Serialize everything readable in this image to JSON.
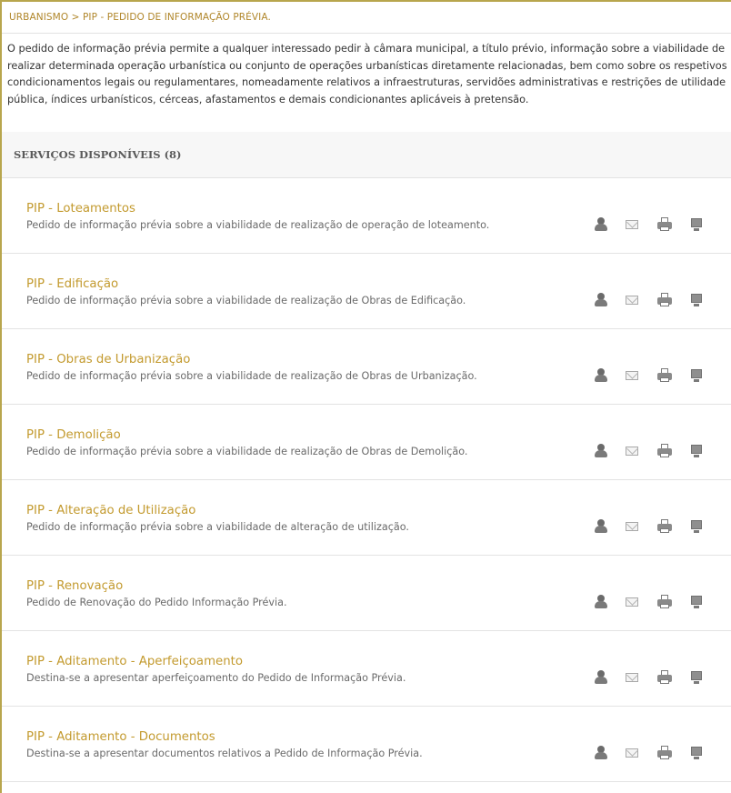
{
  "breadcrumb": "URBANISMO > PIP - PEDIDO DE INFORMAÇÃO PRÉVIA.",
  "intro": "O pedido de informação prévia permite a qualquer interessado pedir à câmara municipal, a título prévio, informação sobre a viabilidade de realizar determinada operação urbanística ou conjunto de operações urbanísticas diretamente relacionadas, bem como sobre os respetivos condicionamentos legais ou regulamentares, nomeadamente relativos a infraestruturas, servidões administrativas e restrições de utilidade pública, índices urbanísticos, cérceas, afastamentos e demais condicionantes aplicáveis à pretensão.",
  "section_title": "SERVIÇOS DISPONÍVEIS (8)",
  "services": [
    {
      "title": "PIP - Loteamentos",
      "description": "Pedido de informação prévia sobre a viabilidade de realização de operação de loteamento."
    },
    {
      "title": "PIP - Edificação",
      "description": "Pedido de informação prévia sobre a viabilidade de realização de Obras de Edificação."
    },
    {
      "title": "PIP - Obras de Urbanização",
      "description": "Pedido de informação prévia sobre a viabilidade de realização de Obras de Urbanização."
    },
    {
      "title": "PIP - Demolição",
      "description": "Pedido de informação prévia sobre a viabilidade de realização de Obras de Demolição."
    },
    {
      "title": "PIP - Alteração de Utilização",
      "description": "Pedido de informação prévia sobre a viabilidade de alteração de utilização."
    },
    {
      "title": "PIP - Renovação",
      "description": "Pedido de Renovação do Pedido Informação Prévia."
    },
    {
      "title": "PIP - Aditamento - Aperfeiçoamento",
      "description": "Destina-se a apresentar aperfeiçoamento do Pedido de Informação Prévia."
    },
    {
      "title": "PIP - Aditamento - Documentos",
      "description": "Destina-se a apresentar documentos relativos a Pedido de Informação Prévia."
    }
  ],
  "service_icons": [
    "person-icon",
    "mail-icon",
    "printer-icon",
    "monitor-icon"
  ],
  "colors": {
    "accent": "#c39a2e",
    "border": "#b8a64d"
  }
}
